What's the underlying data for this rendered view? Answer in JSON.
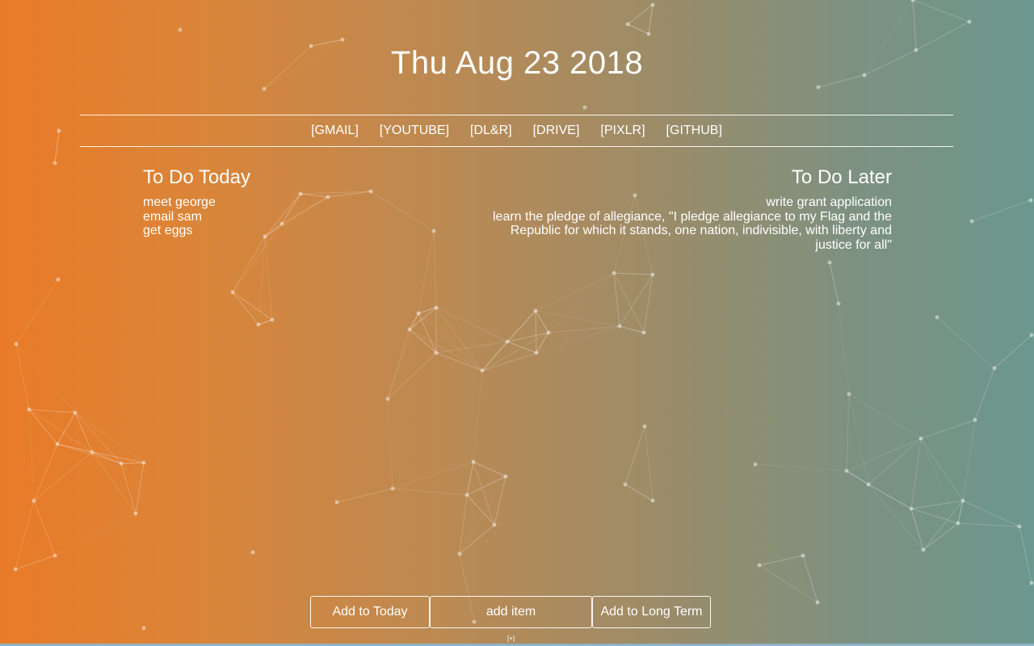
{
  "header": {
    "date": "Thu Aug 23 2018"
  },
  "nav": {
    "links": [
      "[GMAIL]",
      "[YOUTUBE]",
      "[DL&R]",
      "[DRIVE]",
      "[PIXLR]",
      "[GITHUB]"
    ]
  },
  "today": {
    "heading": "To Do Today",
    "items": [
      "meet george",
      "email sam",
      "get eggs"
    ]
  },
  "later": {
    "heading": "To Do Later",
    "items": [
      "write grant application",
      "learn the pledge of allegiance, \"I pledge allegiance to my Flag and the Republic for which it stands, one nation, indivisible, with liberty and justice for all\""
    ]
  },
  "controls": {
    "add_today_label": "Add to Today",
    "input_placeholder": "add item",
    "add_long_label": "Add to Long Term",
    "toggle_label": "[+]"
  },
  "colors": {
    "gradient_left": "#e97b28",
    "gradient_right": "#6c978e",
    "text": "#ffffff"
  }
}
